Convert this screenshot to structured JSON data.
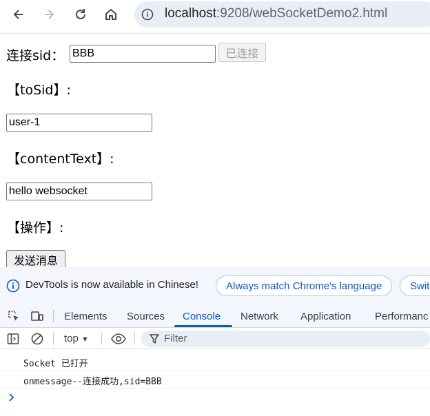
{
  "browser": {
    "url_host": "localhost",
    "url_path": ":9208/webSocketDemo2.html",
    "icons": [
      "back-icon",
      "forward-icon",
      "reload-icon",
      "home-icon",
      "site-info-icon"
    ]
  },
  "page": {
    "sid_label": "连接sid：",
    "sid_value": "BBB",
    "connect_button": "已连接",
    "tosid_label": "【toSid】:",
    "tosid_value": "user-1",
    "content_label": "【contentText】:",
    "content_value": "hello websocket",
    "operation_label": "【操作】:",
    "send_button": "发送消息"
  },
  "devtools": {
    "notice_text": "DevTools is now available in Chinese!",
    "notice_button": "Always match Chrome's language",
    "notice_button2": "Swit",
    "tabs": [
      "Elements",
      "Sources",
      "Console",
      "Network",
      "Application",
      "Performanc"
    ],
    "active_tab": "Console",
    "context": "top",
    "context_arrow": "▼",
    "filter_placeholder": "Filter",
    "logs": [
      "Socket 已打开",
      "onmessage--连接成功,sid=BBB"
    ],
    "colors": {
      "accent": "#0b57d0",
      "notice_bg": "#f3f6fc"
    }
  }
}
